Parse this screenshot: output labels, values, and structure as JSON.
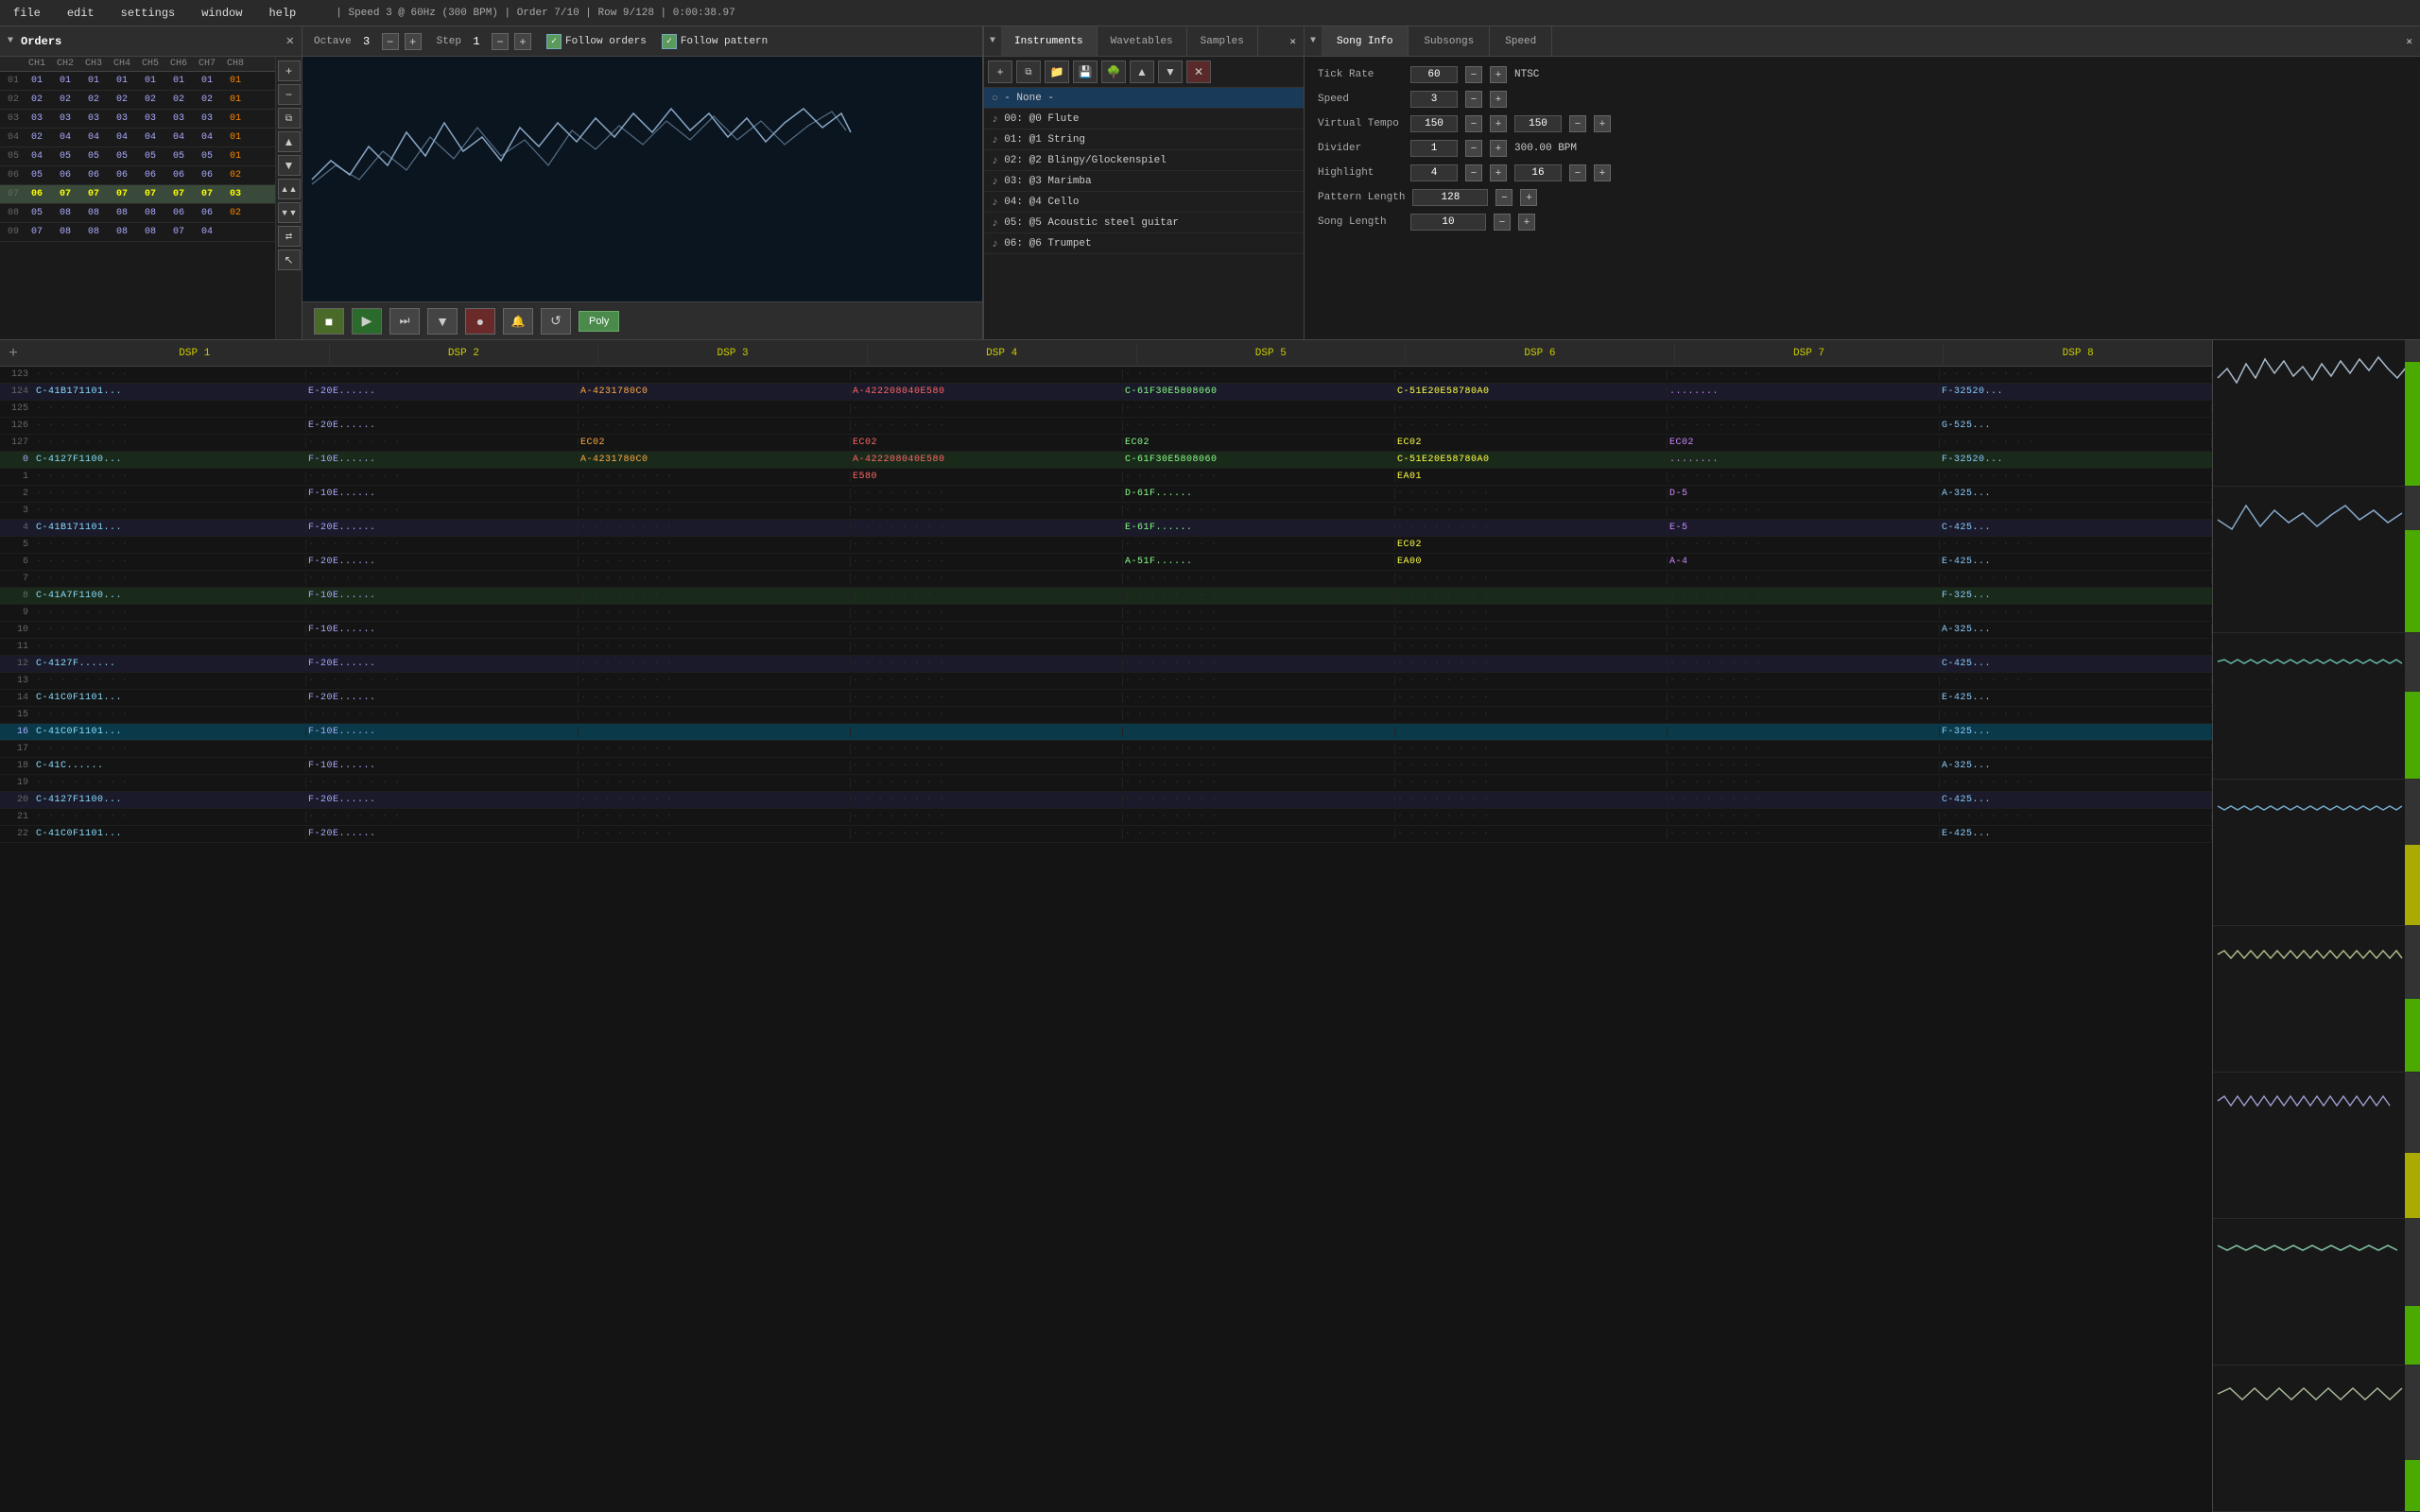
{
  "menubar": {
    "items": [
      "file",
      "edit",
      "settings",
      "window",
      "help"
    ],
    "labels": [
      "file",
      "edit",
      "settings",
      "window",
      "help"
    ],
    "status": "| Speed 3 @ 60Hz (300 BPM) | Order 7/10 | Row 9/128 | 0:00:38.97"
  },
  "orders_panel": {
    "title": "Orders",
    "columns": [
      "CH1",
      "CH2",
      "CH3",
      "CH4",
      "CH5",
      "CH6",
      "CH7",
      "CH8"
    ],
    "rows": [
      {
        "num": "01",
        "cells": [
          "01",
          "01",
          "01",
          "01",
          "01",
          "01",
          "01",
          "01"
        ]
      },
      {
        "num": "02",
        "cells": [
          "02",
          "02",
          "02",
          "02",
          "02",
          "02",
          "02",
          "01"
        ]
      },
      {
        "num": "03",
        "cells": [
          "03",
          "03",
          "03",
          "03",
          "03",
          "03",
          "03",
          "01"
        ]
      },
      {
        "num": "04",
        "cells": [
          "02",
          "04",
          "04",
          "04",
          "04",
          "04",
          "04",
          "01"
        ]
      },
      {
        "num": "05",
        "cells": [
          "04",
          "05",
          "05",
          "05",
          "05",
          "05",
          "05",
          "01"
        ]
      },
      {
        "num": "06",
        "cells": [
          "05",
          "06",
          "06",
          "06",
          "06",
          "06",
          "06",
          "02"
        ]
      },
      {
        "num": "07",
        "cells": [
          "06",
          "07",
          "07",
          "07",
          "07",
          "07",
          "07",
          "03"
        ],
        "highlight": true
      },
      {
        "num": "08",
        "cells": [
          "05",
          "08",
          "08",
          "08",
          "08",
          "06",
          "06",
          "02"
        ]
      },
      {
        "num": "09",
        "cells": [
          "07",
          "08",
          "08",
          "08",
          "08",
          "07",
          "04",
          ""
        ]
      }
    ]
  },
  "octave": {
    "label": "Octave",
    "value": "3"
  },
  "step": {
    "label": "Step",
    "value": "1"
  },
  "follow_orders": {
    "label": "Follow orders",
    "checked": true
  },
  "follow_pattern": {
    "label": "Follow pattern",
    "checked": true
  },
  "instruments": {
    "tabs": [
      "Instruments",
      "Wavetables",
      "Samples"
    ],
    "active_tab": "Instruments",
    "toolbar_buttons": [
      "+",
      "copy",
      "folder",
      "save",
      "tree",
      "up",
      "down",
      "x"
    ],
    "items": [
      {
        "id": "none",
        "name": "- None -",
        "icon": "○"
      },
      {
        "id": "00",
        "name": "00: @0 Flute",
        "icon": "♪"
      },
      {
        "id": "01",
        "name": "01: @1 String",
        "icon": "♪"
      },
      {
        "id": "02",
        "name": "02: @2 Blingy/Glockenspiel",
        "icon": "♪"
      },
      {
        "id": "03",
        "name": "03: @3 Marimba",
        "icon": "♪"
      },
      {
        "id": "04",
        "name": "04: @4 Cello",
        "icon": "♪"
      },
      {
        "id": "05",
        "name": "05: @5 Acoustic steel guitar",
        "icon": "♪"
      },
      {
        "id": "06",
        "name": "06: @6 Trumpet",
        "icon": "♪"
      }
    ]
  },
  "song_info": {
    "tabs": [
      "Song Info",
      "Subsongs",
      "Speed"
    ],
    "tick_rate_label": "Tick Rate",
    "tick_rate_value": "60",
    "tick_rate_type": "NTSC",
    "speed_label": "Speed",
    "speed_value": "3",
    "virtual_tempo_label": "Virtual Tempo",
    "virtual_tempo_value1": "150",
    "virtual_tempo_value2": "150",
    "divider_label": "Divider",
    "divider_value": "1",
    "bpm_display": "300.00 BPM",
    "highlight_label": "Highlight",
    "highlight_value1": "4",
    "highlight_value2": "16",
    "pattern_length_label": "Pattern Length",
    "pattern_length_value": "128",
    "song_length_label": "Song Length",
    "song_length_value": "10"
  },
  "dsp_columns": [
    "DSP  1",
    "DSP  2",
    "DSP  3",
    "DSP  4",
    "DSP  5",
    "DSP  6",
    "DSP  7",
    "DSP  8"
  ],
  "tracker_rows": [
    {
      "num": "123",
      "cells": [
        "",
        "",
        "",
        "",
        "",
        "",
        "",
        ""
      ]
    },
    {
      "num": "124",
      "cells": [
        "C-41B171101...",
        "E-20E......",
        "A-4231780C0",
        "A-422208040E580",
        "C-61F30E5808060",
        "C-51E20E58780A0",
        "........",
        "F-32520..."
      ]
    },
    {
      "num": "125",
      "cells": [
        "",
        "",
        "",
        "",
        "",
        "",
        "",
        ""
      ]
    },
    {
      "num": "126",
      "cells": [
        "",
        "E-20E......",
        "",
        "",
        "",
        "",
        "",
        "G-525..."
      ]
    },
    {
      "num": "127",
      "cells": [
        "",
        "",
        "EC02",
        "EC02",
        "EC02",
        "EC02",
        "EC02",
        ""
      ]
    },
    {
      "num": "0",
      "cells": [
        "C-4127F1100...",
        "F-10E......",
        "A-4231780C0",
        "A-422208040E580",
        "C-61F30E5808060",
        "C-51E20E58780A0",
        "........",
        "F-32520..."
      ],
      "highlight": true
    },
    {
      "num": "1",
      "cells": [
        "",
        "",
        "",
        "E580",
        "",
        "EA01",
        "",
        ""
      ]
    },
    {
      "num": "2",
      "cells": [
        "",
        "F-10E......",
        "",
        "",
        "D-61F......",
        "",
        "D-5",
        "A-325..."
      ]
    },
    {
      "num": "3",
      "cells": [
        "",
        "",
        "",
        "",
        "",
        "",
        "",
        ""
      ]
    },
    {
      "num": "4",
      "cells": [
        "C-41B171101...",
        "F-20E......",
        "",
        "",
        "E-61F......",
        "",
        "E-5",
        "C-425..."
      ]
    },
    {
      "num": "5",
      "cells": [
        "",
        "",
        "",
        "",
        "",
        "EC02",
        "",
        ""
      ]
    },
    {
      "num": "6",
      "cells": [
        "",
        "F-20E......",
        "",
        "",
        "A-51F......",
        "EA00",
        "A-4",
        "E-425..."
      ]
    },
    {
      "num": "7",
      "cells": [
        "",
        "",
        "",
        "",
        "",
        "",
        "",
        ""
      ]
    },
    {
      "num": "8",
      "cells": [
        "C-41A7F1100...",
        "F-10E......",
        "",
        "",
        "",
        "",
        "",
        "F-325..."
      ],
      "highlight": true
    },
    {
      "num": "9",
      "cells": [
        "",
        "",
        "",
        "",
        "",
        "",
        "",
        ""
      ]
    },
    {
      "num": "10",
      "cells": [
        "",
        "F-10E......",
        "",
        "",
        "",
        "",
        "",
        "A-325..."
      ]
    },
    {
      "num": "11",
      "cells": [
        "",
        "",
        "",
        "",
        "",
        "",
        "",
        ""
      ]
    },
    {
      "num": "12",
      "cells": [
        "C-4127F......",
        "F-20E......",
        "",
        "",
        "",
        "",
        "",
        "C-425..."
      ]
    },
    {
      "num": "13",
      "cells": [
        "",
        "",
        "",
        "",
        "",
        "",
        "",
        ""
      ]
    },
    {
      "num": "14",
      "cells": [
        "C-41C0F1101...",
        "F-20E......",
        "",
        "",
        "",
        "",
        "",
        "E-425..."
      ]
    },
    {
      "num": "15",
      "cells": [
        "",
        "",
        "",
        "",
        "",
        "",
        "",
        ""
      ]
    },
    {
      "num": "16",
      "cells": [
        "C-41C0F1101...",
        "F-10E......",
        "",
        "",
        "",
        "",
        "",
        "F-325..."
      ],
      "current": true
    },
    {
      "num": "17",
      "cells": [
        "",
        "",
        "",
        "",
        "",
        "",
        "",
        ""
      ]
    },
    {
      "num": "18",
      "cells": [
        "C-41C......",
        "F-10E......",
        "",
        "",
        "",
        "",
        "",
        "A-325..."
      ]
    },
    {
      "num": "19",
      "cells": [
        "",
        "",
        "",
        "",
        "",
        "",
        "",
        ""
      ]
    },
    {
      "num": "20",
      "cells": [
        "C-4127F1100...",
        "F-20E......",
        "",
        "",
        "",
        "",
        "",
        "C-425..."
      ]
    },
    {
      "num": "21",
      "cells": [
        "",
        "",
        "",
        "",
        "",
        "",
        "",
        ""
      ]
    },
    {
      "num": "22",
      "cells": [
        "C-41C0F1101...",
        "F-20E......",
        "",
        "",
        "",
        "",
        "",
        "E-425..."
      ]
    }
  ],
  "transport": {
    "stop_label": "■",
    "play_label": "▶",
    "skip_label": "⏭",
    "down_label": "▼",
    "record_label": "●",
    "bell_label": "🔔",
    "repeat_label": "↺",
    "poly_label": "Poly"
  }
}
